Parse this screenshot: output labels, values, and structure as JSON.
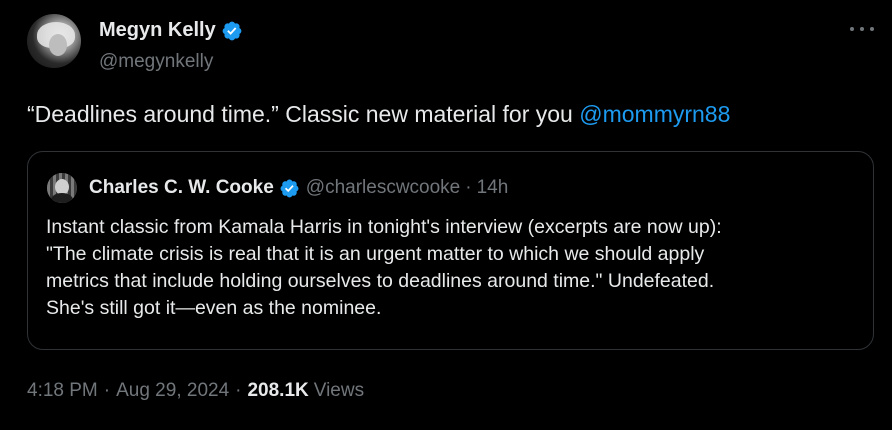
{
  "author": {
    "display_name": "Megyn Kelly",
    "handle": "@megynkelly"
  },
  "tweet": {
    "text": "“Deadlines around time.” Classic new material for you ",
    "mention": "@mommyrn88"
  },
  "quote": {
    "display_name": "Charles C. W. Cooke",
    "handle": "@charlescwcooke",
    "separator": "·",
    "time": "14h",
    "lines": [
      "Instant classic from Kamala Harris in tonight's interview (excerpts are now up):",
      "\"The climate crisis is real that it is an urgent matter to which we should apply",
      "metrics that include holding ourselves to deadlines around time.\" Undefeated.",
      "She's still got it—even as the nominee."
    ]
  },
  "meta": {
    "time": "4:18 PM",
    "separator": "·",
    "date": "Aug 29, 2024",
    "separator2": "·",
    "views_count": "208.1K",
    "views_label": "Views"
  },
  "icons": {
    "verified": "verified-badge-icon",
    "more": "more-options-icon"
  },
  "colors": {
    "background": "#000000",
    "text": "#e7e9ea",
    "secondary": "#71767b",
    "accent": "#1d9bf0",
    "border": "#2f3336"
  }
}
